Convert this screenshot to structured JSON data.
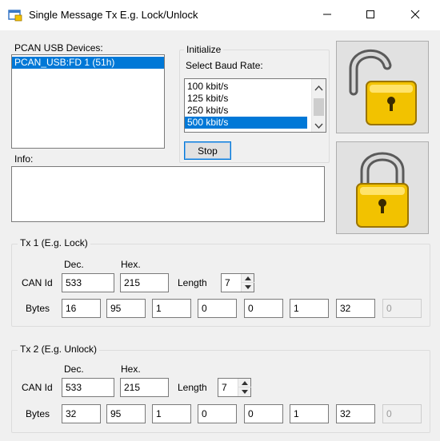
{
  "window": {
    "title": "Single Message Tx E.g. Lock/Unlock",
    "minimize_icon": "minimize-icon",
    "maximize_icon": "maximize-icon",
    "close_icon": "close-icon"
  },
  "devices": {
    "label": "PCAN USB Devices:",
    "items": [
      {
        "label": "PCAN_USB:FD 1 (51h)",
        "selected": true
      }
    ]
  },
  "initialize": {
    "group_title": "Initialize",
    "baud_label": "Select Baud Rate:",
    "baud_options": [
      {
        "label": "100 kbit/s",
        "selected": false
      },
      {
        "label": "125 kbit/s",
        "selected": false
      },
      {
        "label": "250 kbit/s",
        "selected": false
      },
      {
        "label": "500 kbit/s",
        "selected": true
      }
    ],
    "stop_button": "Stop"
  },
  "info": {
    "label": "Info:",
    "value": ""
  },
  "lock_buttons": {
    "unlock_icon": "unlocked-padlock-icon",
    "lock_icon": "locked-padlock-icon",
    "accent": "#f2c200"
  },
  "tx1": {
    "group_title": "Tx 1 (E.g. Lock)",
    "dec_header": "Dec.",
    "hex_header": "Hex.",
    "can_id_label": "CAN Id",
    "can_id_dec": "533",
    "can_id_hex": "215",
    "length_label": "Length",
    "length": "7",
    "bytes_label": "Bytes",
    "bytes": [
      "16",
      "95",
      "1",
      "0",
      "0",
      "1",
      "32",
      "0"
    ]
  },
  "tx2": {
    "group_title": "Tx 2 (E.g. Unlock)",
    "dec_header": "Dec.",
    "hex_header": "Hex.",
    "can_id_label": "CAN Id",
    "can_id_dec": "533",
    "can_id_hex": "215",
    "length_label": "Length",
    "length": "7",
    "bytes_label": "Bytes",
    "bytes": [
      "32",
      "95",
      "1",
      "0",
      "0",
      "1",
      "32",
      "0"
    ]
  }
}
